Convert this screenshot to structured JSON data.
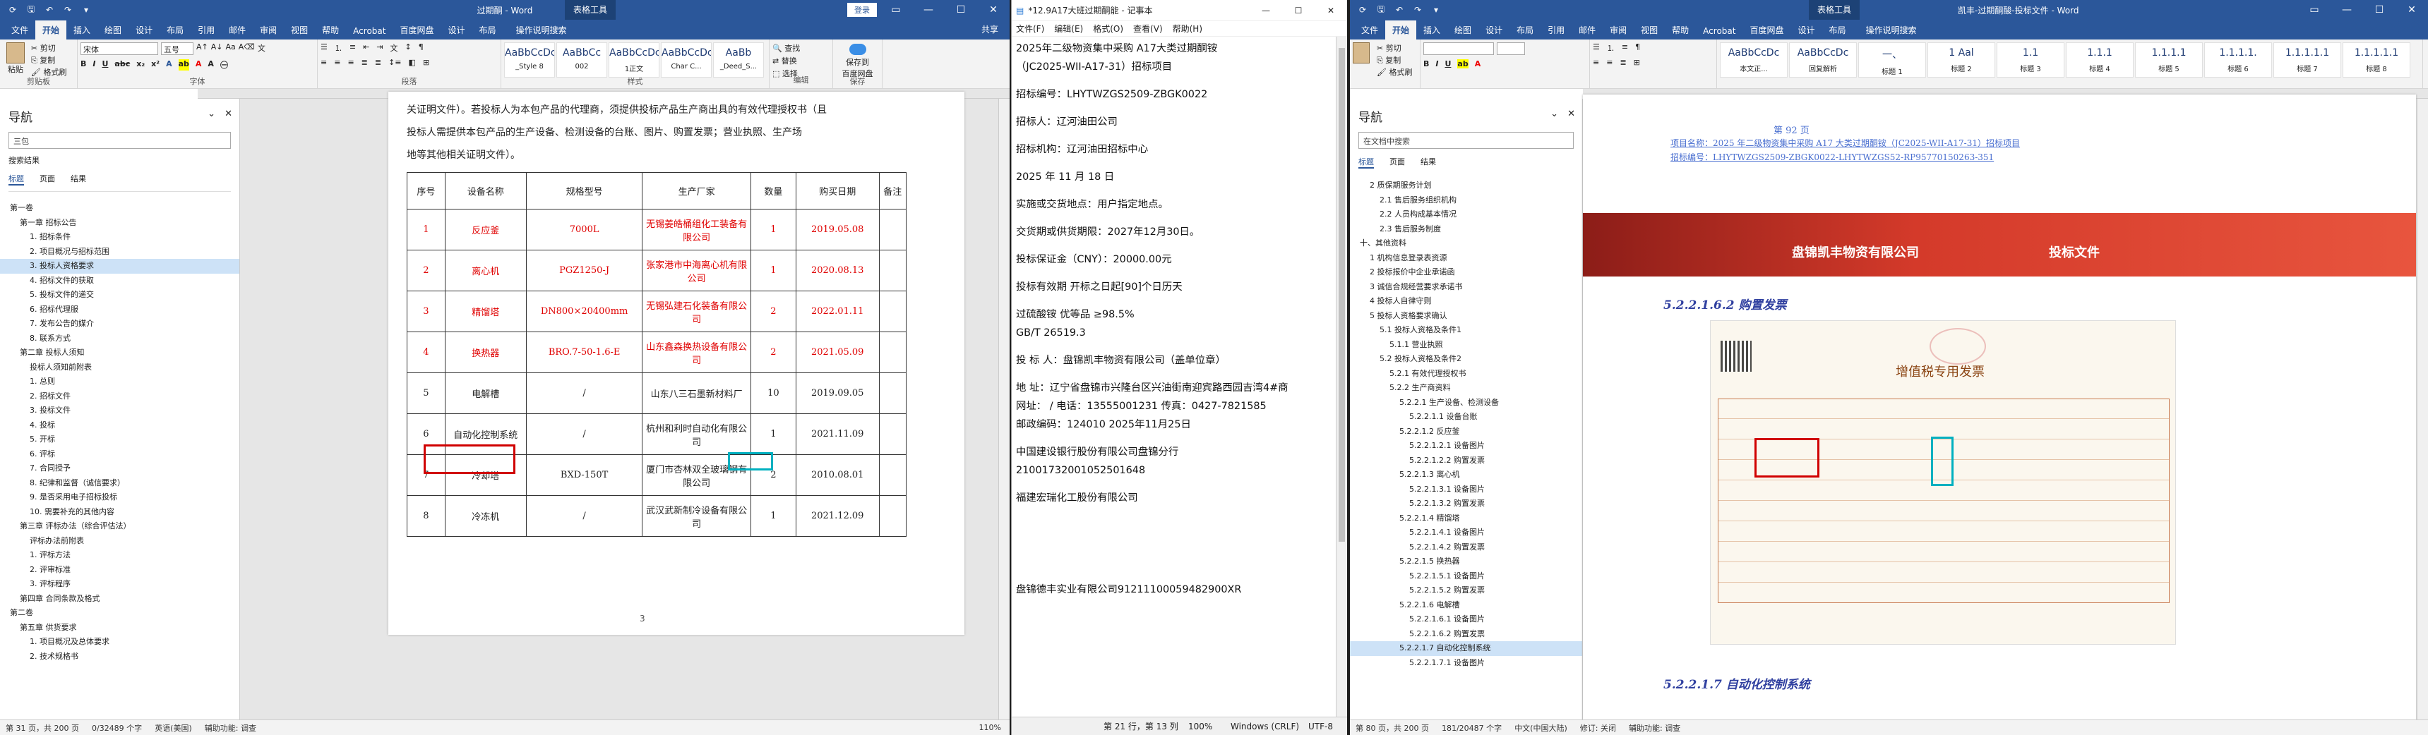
{
  "w1": {
    "title": "过期酮 - Word",
    "ctx_tab": "表格工具",
    "signin": "登录",
    "tabs": [
      "文件",
      "开始",
      "插入",
      "绘图",
      "设计",
      "布局",
      "引用",
      "邮件",
      "审阅",
      "视图",
      "帮助",
      "Acrobat",
      "百度网盘",
      "设计",
      "布局"
    ],
    "search": "操作说明搜索",
    "share": "共享",
    "clip": {
      "paste": "粘贴",
      "cut": "剪切",
      "copy": "复制",
      "fmt": "格式刷",
      "label": "剪贴板"
    },
    "font": {
      "name": "宋体",
      "size": "五号",
      "label": "字体"
    },
    "para_label": "段落",
    "styles": [
      {
        "s": "AaBbCcDc",
        "n": "_Style 8"
      },
      {
        "s": "AaBbCc",
        "n": "002"
      },
      {
        "s": "AaBbCcDc",
        "n": "1正文"
      },
      {
        "s": "AaBbCcDc",
        "n": "Char C..."
      },
      {
        "s": "AaBb",
        "n": "_Deed_S..."
      }
    ],
    "styles_label": "样式",
    "edit": {
      "find": "查找",
      "replace": "替换",
      "select": "选择",
      "label": "编辑"
    },
    "save_baidu": {
      "l1": "保存到",
      "l2": "百度网盘",
      "label": "保存"
    },
    "nav": {
      "title": "导航",
      "search": "三包",
      "sub": "搜索结果",
      "tabs": [
        "标题",
        "页面",
        "结果"
      ],
      "items": [
        {
          "t": "第一卷",
          "l": 0
        },
        {
          "t": "第一章 招标公告",
          "l": 1
        },
        {
          "t": "1. 招标条件",
          "l": 2
        },
        {
          "t": "2. 项目概况与招标范围",
          "l": 2
        },
        {
          "t": "3. 投标人资格要求",
          "l": 2,
          "hl": true
        },
        {
          "t": "4. 招标文件的获取",
          "l": 2
        },
        {
          "t": "5. 投标文件的递交",
          "l": 2
        },
        {
          "t": "6. 招标代理服",
          "l": 2
        },
        {
          "t": "7. 发布公告的媒介",
          "l": 2
        },
        {
          "t": "8. 联系方式",
          "l": 2
        },
        {
          "t": "第二章 投标人须知",
          "l": 1
        },
        {
          "t": "投标人须知前附表",
          "l": 2
        },
        {
          "t": "1. 总则",
          "l": 2
        },
        {
          "t": "2. 招标文件",
          "l": 2
        },
        {
          "t": "3. 投标文件",
          "l": 2
        },
        {
          "t": "4. 投标",
          "l": 2
        },
        {
          "t": "5. 开标",
          "l": 2
        },
        {
          "t": "6. 评标",
          "l": 2
        },
        {
          "t": "7. 合同授予",
          "l": 2
        },
        {
          "t": "8. 纪律和监督（诚信要求）",
          "l": 2
        },
        {
          "t": "9. 是否采用电子招标投标",
          "l": 2
        },
        {
          "t": "10. 需要补充的其他内容",
          "l": 2
        },
        {
          "t": "第三章 评标办法（综合评估法）",
          "l": 1
        },
        {
          "t": "评标办法前附表",
          "l": 2
        },
        {
          "t": "1. 评标方法",
          "l": 2
        },
        {
          "t": "2. 评审标准",
          "l": 2
        },
        {
          "t": "3. 评标程序",
          "l": 2
        },
        {
          "t": "第四章 合同条款及格式",
          "l": 1
        },
        {
          "t": "第二卷",
          "l": 0
        },
        {
          "t": "第五章 供货要求",
          "l": 1
        },
        {
          "t": "1. 项目概况及总体要求",
          "l": 2
        },
        {
          "t": "2. 技术规格书",
          "l": 2
        }
      ]
    },
    "doc": {
      "intro": [
        "关证明文件）。若投标人为本包产品的代理商，须提供投标产品生产商出具的有效代理授权书（且",
        "投标人需提供本包产品的生产设备、检测设备的台账、图片、购置发票；营业执照、生产场",
        "地等其他相关证明文件）。"
      ],
      "headers": [
        "序号",
        "设备名称",
        "规格型号",
        "生产厂家",
        "数量",
        "购买日期",
        "备注"
      ],
      "rows": [
        {
          "no": "1",
          "name": "反应釜",
          "spec": "7000L",
          "maker": "无锡姜皓桶组化工装备有限公司",
          "qty": "1",
          "date": "2019.05.08",
          "red": true
        },
        {
          "no": "2",
          "name": "离心机",
          "spec": "PGZ1250-J",
          "maker": "张家港市中海离心机有限公司",
          "qty": "1",
          "date": "2020.08.13",
          "red": true
        },
        {
          "no": "3",
          "name": "精馏塔",
          "spec": "DN800×20400mm",
          "maker": "无锡弘建石化装备有限公司",
          "qty": "2",
          "date": "2022.01.11",
          "red": true
        },
        {
          "no": "4",
          "name": "换热器",
          "spec": "BRO.7-50-1.6-E",
          "maker": "山东鑫森换热设备有限公司",
          "qty": "2",
          "date": "2021.05.09",
          "red": true
        },
        {
          "no": "5",
          "name": "电解槽",
          "spec": "/",
          "maker": "山东八三石墨新材料厂",
          "qty": "10",
          "date": "2019.09.05",
          "red": false
        },
        {
          "no": "6",
          "name": "自动化控制系统",
          "spec": "/",
          "maker": "杭州和利时自动化有限公司",
          "qty": "1",
          "date": "2021.11.09",
          "red": false
        },
        {
          "no": "7",
          "name": "冷却塔",
          "spec": "BXD-150T",
          "maker": "厦门市杏林双全玻璃钢有限公司",
          "qty": "2",
          "date": "2010.08.01",
          "red": false
        },
        {
          "no": "8",
          "name": "冷冻机",
          "spec": "/",
          "maker": "武汉武新制冷设备有限公司",
          "qty": "1",
          "date": "2021.12.09",
          "red": false
        }
      ],
      "pagenum": "3"
    },
    "status": {
      "page": "第 31 页，共 200 页",
      "words": "0/32489 个字",
      "lang": "英语(美国)",
      "assist": "辅助功能: 调查",
      "zoom": "110%"
    }
  },
  "w2": {
    "title": "*12.9A17大班过期酮能 - 记事本",
    "menu": [
      "文件(F)",
      "编辑(E)",
      "格式(O)",
      "查看(V)",
      "帮助(H)"
    ],
    "lines": [
      "2025年二级物资集中采购 A17大类过期酮铵",
      "（JC2025-WII-A17-31）招标项目",
      "",
      "招标编号：LHYTWZGS2509-ZBGK0022",
      "",
      "招标人：辽河油田公司",
      "",
      "招标机构：辽河油田招标中心",
      "",
      "2025 年 11 月 18 日",
      "",
      "实施或交货地点：用户指定地点。",
      "",
      "交货期或供货期限：2027年12月30日。",
      "",
      "投标保证金（CNY）：20000.00元",
      "",
      "投标有效期  开标之日起[90]个日历天",
      "",
      "过硫酸铵 优等品 ≥98.5%",
      "GB/T 26519.3",
      "",
      "投 标 人：盘锦凯丰物资有限公司（盖单位章）",
      "",
      "地    址：辽宁省盘锦市兴隆台区兴油街南迎宾路西园吉湾4#商",
      "网址：   / 电话：13555001231    传真：0427-7821585",
      "邮政编码：124010    2025年11月25日",
      "",
      "中国建设银行股份有限公司盘锦分行",
      "21001732001052501648",
      "",
      "福建宏瑞化工股份有限公司",
      "",
      "",
      "",
      "",
      "",
      "",
      "",
      "",
      "盘锦德丰实业有限公司91211100059482900XR"
    ],
    "status": {
      "pos": "第 21 行，第 13 列",
      "zoom": "100%",
      "eol": "Windows (CRLF)",
      "enc": "UTF-8"
    }
  },
  "w3": {
    "title": "凯丰-过期酮酸-投标文件 - Word",
    "ctx_tab": "表格工具",
    "tabs": [
      "文件",
      "开始",
      "插入",
      "绘图",
      "设计",
      "布局",
      "引用",
      "邮件",
      "审阅",
      "视图",
      "帮助",
      "Acrobat",
      "百度网盘",
      "设计",
      "布局"
    ],
    "search": "操作说明搜索",
    "styles": [
      {
        "s": "AaBbCcDc",
        "n": "本文正..."
      },
      {
        "s": "AaBbCcDc",
        "n": "回复解析"
      },
      {
        "s": "一、",
        "n": "标题 1"
      },
      {
        "s": "1 Aal",
        "n": "标题 2"
      },
      {
        "s": "1.1",
        "n": "标题 3"
      },
      {
        "s": "1.1.1",
        "n": "标题 4"
      },
      {
        "s": "1.1.1.1",
        "n": "标题 5"
      },
      {
        "s": "1.1.1.1.",
        "n": "标题 6"
      },
      {
        "s": "1.1.1.1.1",
        "n": "标题 7"
      },
      {
        "s": "1.1.1.1.1",
        "n": "标题 8"
      }
    ],
    "nav": {
      "title": "导航",
      "search": "在文档中搜索",
      "tabs": [
        "标题",
        "页面",
        "结果"
      ],
      "items": [
        {
          "t": "2 质保期服务计划",
          "l": 1
        },
        {
          "t": "2.1 售后服务组织机构",
          "l": 2
        },
        {
          "t": "2.2 人员构成基本情况",
          "l": 2
        },
        {
          "t": "2.3 售后服务制度",
          "l": 2
        },
        {
          "t": "十、其他资料",
          "l": 0
        },
        {
          "t": "1 机构信息登录表资源",
          "l": 1
        },
        {
          "t": "2 投标报价中企业承诺函",
          "l": 1
        },
        {
          "t": "3 诚信合规经营要求承诺书",
          "l": 1
        },
        {
          "t": "4 投标人自律守则",
          "l": 1
        },
        {
          "t": "5 投标人资格要求确认",
          "l": 1
        },
        {
          "t": "5.1 投标人资格及条件1",
          "l": 2
        },
        {
          "t": "5.1.1 营业执照",
          "l": 3
        },
        {
          "t": "5.2 投标人资格及条件2",
          "l": 2
        },
        {
          "t": "5.2.1 有效代理授权书",
          "l": 3
        },
        {
          "t": "5.2.2 生产商资料",
          "l": 3
        },
        {
          "t": "5.2.2.1 生产设备、检测设备",
          "l": 4
        },
        {
          "t": "5.2.2.1.1 设备台账",
          "l": 5
        },
        {
          "t": "5.2.2.1.2 反应釜",
          "l": 4
        },
        {
          "t": "5.2.2.1.2.1 设备图片",
          "l": 5
        },
        {
          "t": "5.2.2.1.2.2 购置发票",
          "l": 5
        },
        {
          "t": "5.2.2.1.3 离心机",
          "l": 4
        },
        {
          "t": "5.2.2.1.3.1 设备图片",
          "l": 5
        },
        {
          "t": "5.2.2.1.3.2 购置发票",
          "l": 5
        },
        {
          "t": "5.2.2.1.4 精馏塔",
          "l": 4
        },
        {
          "t": "5.2.2.1.4.1 设备图片",
          "l": 5
        },
        {
          "t": "5.2.2.1.4.2 购置发票",
          "l": 5
        },
        {
          "t": "5.2.2.1.5 换热器",
          "l": 4
        },
        {
          "t": "5.2.2.1.5.1 设备图片",
          "l": 5
        },
        {
          "t": "5.2.2.1.5.2 购置发票",
          "l": 5
        },
        {
          "t": "5.2.2.1.6 电解槽",
          "l": 4
        },
        {
          "t": "5.2.2.1.6.1 设备图片",
          "l": 5
        },
        {
          "t": "5.2.2.1.6.2 购置发票",
          "l": 5
        },
        {
          "t": "5.2.2.1.7 自动化控制系统",
          "l": 4,
          "hl": true
        },
        {
          "t": "5.2.2.1.7.1 设备图片",
          "l": 5
        }
      ]
    },
    "doc": {
      "pg": "第 92 页",
      "proj_link": "项目名称：2025 年二级物资集中采购 A17 大类过期酮铵（JC2025-WII-A17-31）招标项目",
      "code_link": "招标编号：LHYTWZGS2509-ZBGK0022-LHYTWZGS52-RP95770150263-351",
      "banner_left": "盘锦凯丰物资有限公司",
      "banner_right": "投标文件",
      "h_purchase": "5.2.2.1.6.2  购置发票",
      "invoice_title": "增值税专用发票",
      "h_next": "5.2.2.1.7  自动化控制系统"
    },
    "status": {
      "page": "第 80 页，共 200 页",
      "words": "181/20487 个字",
      "lang": "中文(中国大陆)",
      "track": "修订: 关闭",
      "assist": "辅助功能: 调查"
    }
  },
  "colors": {
    "word_blue": "#2b579a",
    "mark_red": "#d00000",
    "mark_cyan": "#00b0c0",
    "banner": "#c0392b"
  }
}
